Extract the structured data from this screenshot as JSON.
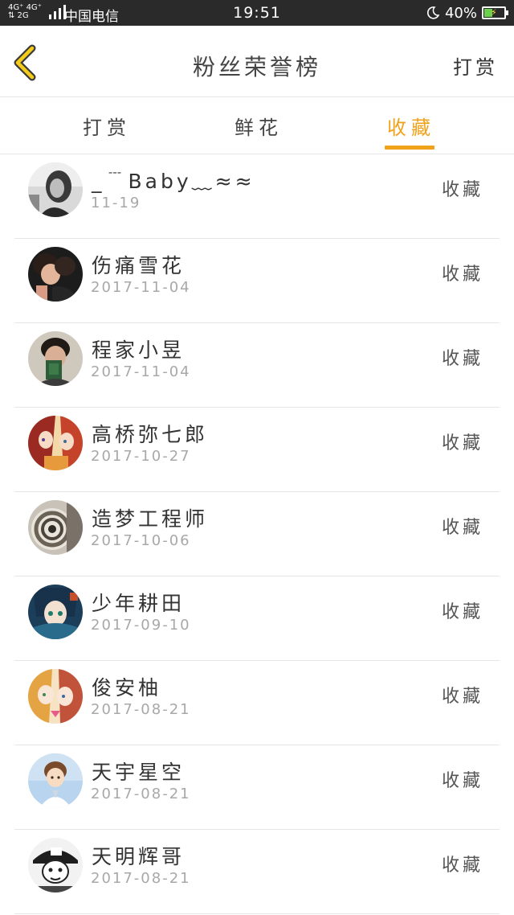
{
  "status_bar": {
    "network_top": "4G⁺ 4G⁺",
    "network_bottom": "⇅ 2G",
    "carrier": "中国电信",
    "time": "19:51",
    "battery_percent": "40%",
    "battery_level": 0.4
  },
  "header": {
    "title": "粉丝荣誉榜",
    "action_label": "打赏"
  },
  "tabs": [
    {
      "label": "打赏",
      "active": false
    },
    {
      "label": "鲜花",
      "active": false
    },
    {
      "label": "收藏",
      "active": true
    }
  ],
  "accent_color": "#f0a21a",
  "list": [
    {
      "name": "_﹉Baby﹏≈≈",
      "date": "11-19",
      "action": "收藏",
      "avatar": "avatar-bw-girl"
    },
    {
      "name": "伤痛雪花",
      "date": "2017-11-04",
      "action": "收藏",
      "avatar": "avatar-couple"
    },
    {
      "name": "程家小昱",
      "date": "2017-11-04",
      "action": "收藏",
      "avatar": "avatar-boy-book"
    },
    {
      "name": "高桥弥七郎",
      "date": "2017-10-27",
      "action": "收藏",
      "avatar": "avatar-anime-girls"
    },
    {
      "name": "造梦工程师",
      "date": "2017-10-06",
      "action": "收藏",
      "avatar": "avatar-spiral"
    },
    {
      "name": "少年耕田",
      "date": "2017-09-10",
      "action": "收藏",
      "avatar": "avatar-anime-boy"
    },
    {
      "name": "俊安柚",
      "date": "2017-08-21",
      "action": "收藏",
      "avatar": "avatar-anime-pair"
    },
    {
      "name": "天宇星空",
      "date": "2017-08-21",
      "action": "收藏",
      "avatar": "avatar-cartoon-boy"
    },
    {
      "name": "天明辉哥",
      "date": "2017-08-21",
      "action": "收藏",
      "avatar": "avatar-manga-cap"
    }
  ]
}
